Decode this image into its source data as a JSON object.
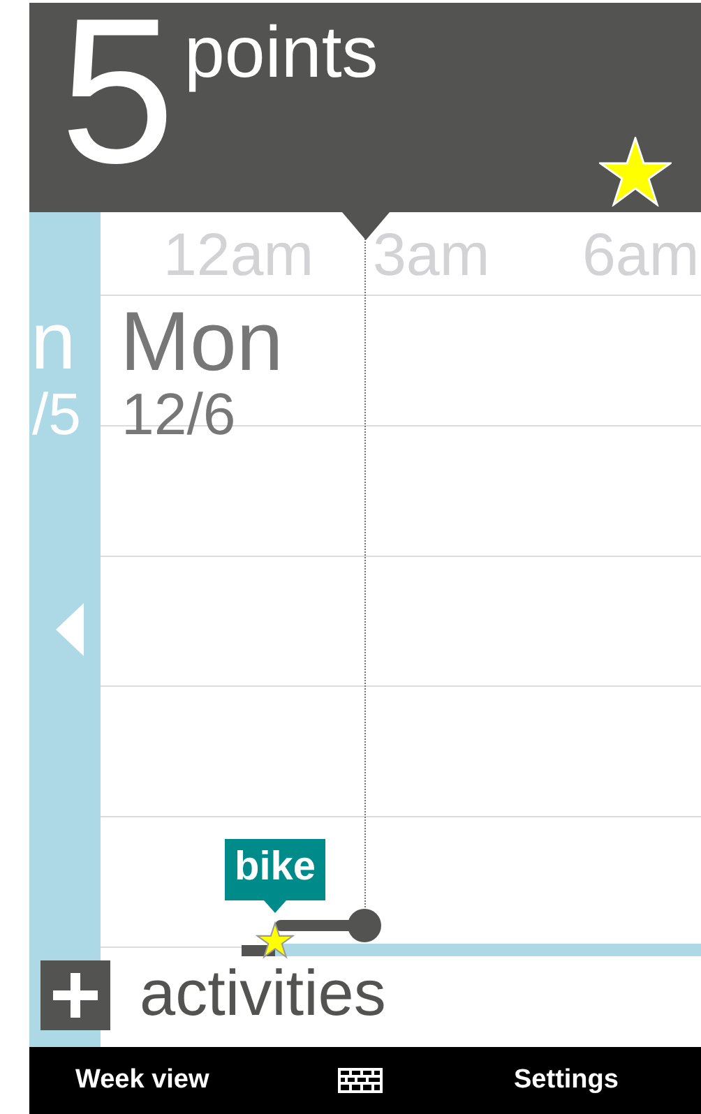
{
  "header": {
    "score": "5",
    "unit": "points"
  },
  "timeline": {
    "hours": [
      "12am",
      "3am",
      "6am"
    ]
  },
  "previous_day": {
    "name": "n",
    "date": "/5"
  },
  "day": {
    "name": "Mon",
    "date": "12/6"
  },
  "events": [
    {
      "label": "bike",
      "color": "#008b8b"
    }
  ],
  "add_activities": {
    "label": "activities"
  },
  "bottom_bar": [
    {
      "kind": "text",
      "label": "Week view"
    },
    {
      "kind": "icon"
    },
    {
      "kind": "text",
      "label": "Settings"
    }
  ]
}
